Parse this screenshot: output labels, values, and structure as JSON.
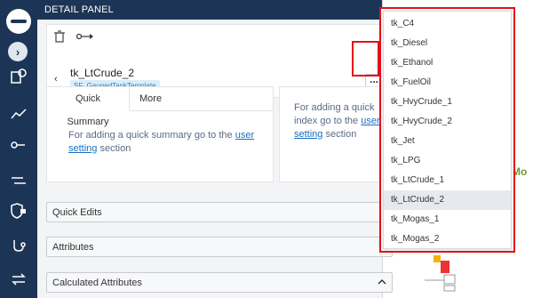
{
  "panel": {
    "title": "DETAIL PANEL"
  },
  "entity": {
    "name": "tk_LtCrude_2",
    "template": "SF_GaugedTankTemplate",
    "back_symbol": "‹",
    "more_symbol": "..."
  },
  "summary": {
    "tabs": [
      "Quick Summary",
      "More"
    ],
    "message_prefix": "For adding a quick summary go to the ",
    "link": "user setting",
    "message_suffix": " section"
  },
  "index": {
    "message_prefix": "For adding a quick index go to the ",
    "link": "user setting",
    "message_suffix": " section"
  },
  "accordions": [
    "Quick Edits",
    "Attributes",
    "Calculated Attributes"
  ],
  "canvas": {
    "label": "Mo"
  },
  "dropdown": {
    "items": [
      "tk_C4",
      "tk_Diesel",
      "tk_Ethanol",
      "tk_FuelOil",
      "tk_HvyCrude_1",
      "tk_HvyCrude_2",
      "tk_Jet",
      "tk_LPG",
      "tk_LtCrude_1",
      "tk_LtCrude_2",
      "tk_Mogas_1",
      "tk_Mogas_2"
    ],
    "selected": "tk_LtCrude_2"
  },
  "colors": {
    "nav": "#1c3557",
    "highlight": "#e3101b",
    "link": "#1a6fc0",
    "chip_bg": "#d9edf9"
  }
}
